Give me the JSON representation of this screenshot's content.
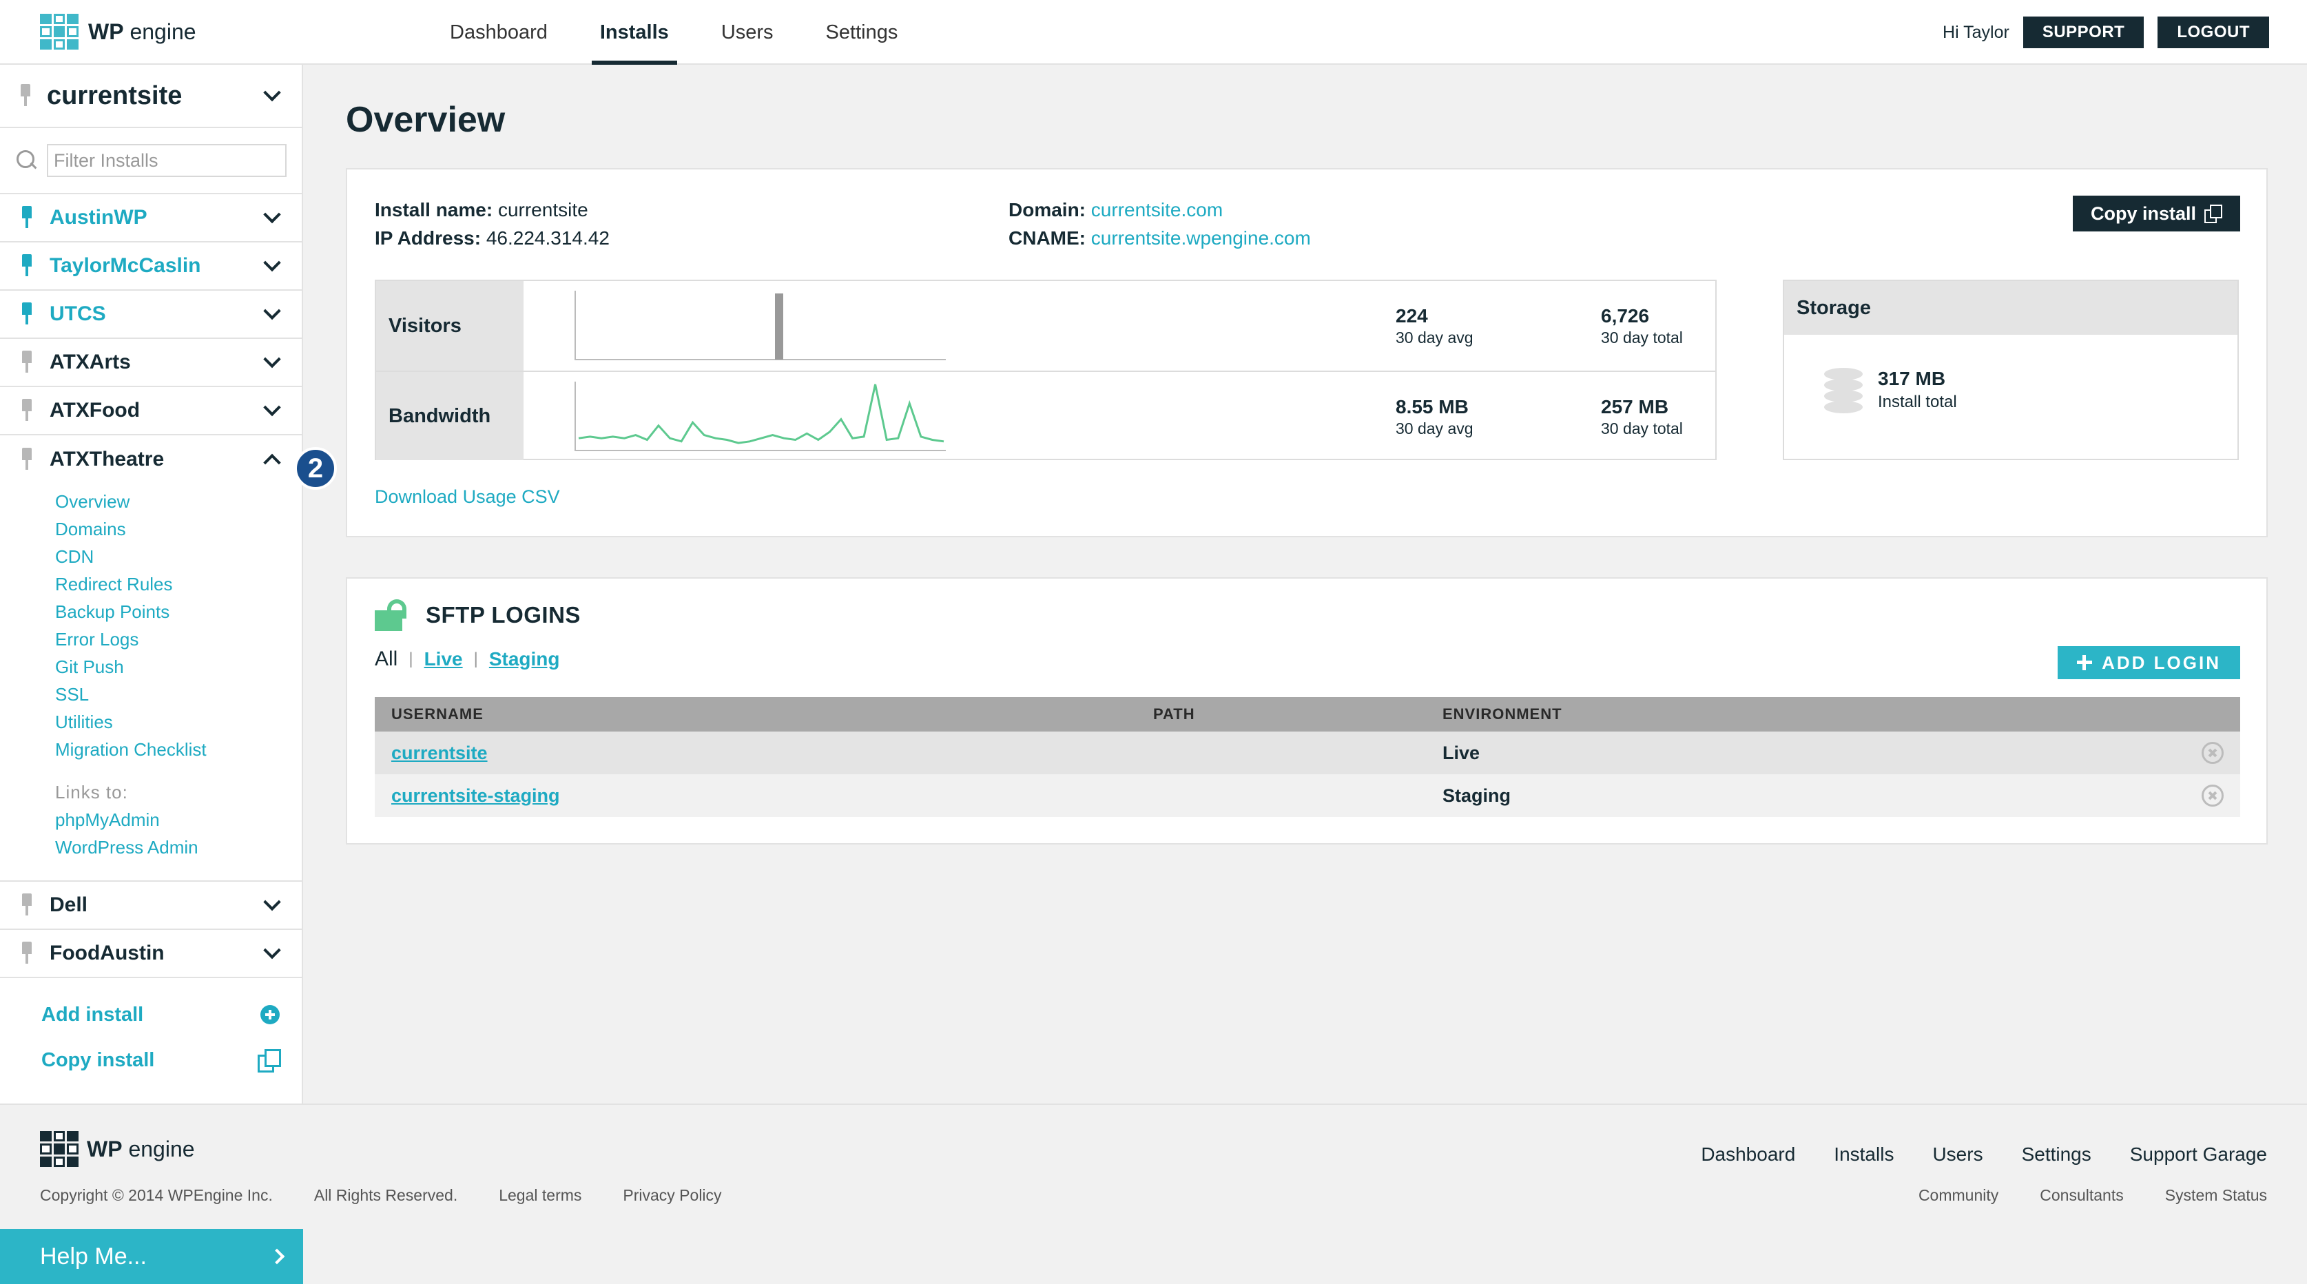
{
  "brand": {
    "logo_bold": "WP",
    "logo_light": "engine"
  },
  "topnav": {
    "tabs": [
      {
        "label": "Dashboard"
      },
      {
        "label": "Installs",
        "active": true
      },
      {
        "label": "Users"
      },
      {
        "label": "Settings"
      }
    ],
    "greeting": "Hi Taylor",
    "support": "SUPPORT",
    "logout": "LOGOUT"
  },
  "sidebar": {
    "current_site": "currentsite",
    "filter_placeholder": "Filter Installs",
    "installs_top": [
      {
        "label": "AustinWP",
        "pinned": true
      },
      {
        "label": "TaylorMcCaslin",
        "pinned": true
      },
      {
        "label": "UTCS",
        "pinned": true
      },
      {
        "label": "ATXArts",
        "pinned": false
      },
      {
        "label": "ATXFood",
        "pinned": false
      }
    ],
    "expanded_install": "ATXTheatre",
    "submenu": [
      "Overview",
      "Domains",
      "CDN",
      "Redirect Rules",
      "Backup Points",
      "Error Logs",
      "Git Push",
      "SSL",
      "Utilities",
      "Migration Checklist"
    ],
    "links_to_label": "Links to:",
    "links": [
      "phpMyAdmin",
      "WordPress Admin"
    ],
    "installs_bottom": [
      {
        "label": "Dell"
      },
      {
        "label": "FoodAustin"
      }
    ],
    "add_install": "Add install",
    "copy_install": "Copy install",
    "badge": "2"
  },
  "main": {
    "title": "Overview",
    "install_name_label": "Install name:",
    "install_name": "currentsite",
    "ip_label": "IP Address:",
    "ip": "46.224.314.42",
    "domain_label": "Domain:",
    "domain": "currentsite.com",
    "cname_label": "CNAME:",
    "cname": "currentsite.wpengine.com",
    "copy_install_button": "Copy install",
    "stats": {
      "visitors_label": "Visitors",
      "visitors_avg": "224",
      "visitors_avg_caption": "30 day avg",
      "visitors_total": "6,726",
      "visitors_total_caption": "30 day total",
      "bandwidth_label": "Bandwidth",
      "bandwidth_avg": "8.55 MB",
      "bandwidth_avg_caption": "30 day avg",
      "bandwidth_total": "257 MB",
      "bandwidth_total_caption": "30 day total"
    },
    "storage": {
      "title": "Storage",
      "value": "317 MB",
      "caption": "Install total"
    },
    "download_csv": "Download Usage CSV"
  },
  "sftp": {
    "title": "SFTP LOGINS",
    "filter_all": "All",
    "filter_live": "Live",
    "filter_staging": "Staging",
    "add_login": "ADD LOGIN",
    "columns": {
      "username": "USERNAME",
      "path": "PATH",
      "environment": "ENVIRONMENT"
    },
    "rows": [
      {
        "username": "currentsite",
        "path": "",
        "environment": "Live"
      },
      {
        "username": "currentsite-staging",
        "path": "",
        "environment": "Staging"
      }
    ]
  },
  "footer": {
    "copyright": "Copyright © 2014 WPEngine Inc.",
    "rights": "All Rights Reserved.",
    "legal": "Legal terms",
    "privacy": "Privacy Policy",
    "nav": [
      "Dashboard",
      "Installs",
      "Users",
      "Settings",
      "Support Garage"
    ],
    "subnav": [
      "Community",
      "Consultants",
      "System Status"
    ]
  },
  "help": "Help Me...",
  "chart_data": [
    {
      "type": "bar",
      "series": [
        {
          "values": [
            0,
            0,
            0,
            0,
            0,
            0,
            0,
            0,
            0,
            0,
            0,
            0,
            0,
            0,
            0,
            0,
            1,
            0,
            0,
            0,
            0,
            0,
            0,
            0,
            0,
            0,
            0,
            0,
            0,
            0
          ]
        }
      ]
    },
    {
      "type": "line",
      "series": [
        {
          "values": [
            6,
            7,
            6,
            7,
            6,
            8,
            5,
            14,
            6,
            4,
            16,
            8,
            6,
            5,
            3,
            4,
            6,
            8,
            6,
            5,
            9,
            5,
            10,
            18,
            6,
            7,
            40,
            5,
            6,
            28,
            7,
            5,
            4
          ]
        }
      ]
    }
  ],
  "colors": {
    "accent": "#1eaac2",
    "dark": "#162a33",
    "green": "#5dc98f"
  }
}
